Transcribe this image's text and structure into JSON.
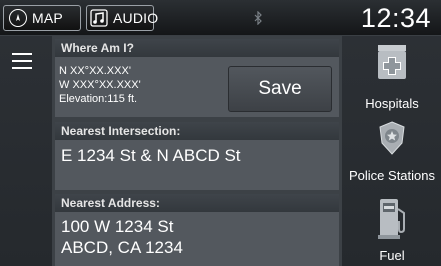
{
  "topbar": {
    "map_label": "MAP",
    "audio_label": "AUDIO",
    "time": "12:34"
  },
  "where_am_i": {
    "header": "Where Am I?",
    "latitude": "N XX°XX.XXX'",
    "longitude": "W XXX°XX.XXX'",
    "elevation": "Elevation:115 ft.",
    "save_label": "Save"
  },
  "nearest_intersection": {
    "header": "Nearest Intersection:",
    "value": "E 1234 St & N ABCD St"
  },
  "nearest_address": {
    "header": "Nearest Address:",
    "line1": "100 W 1234 St",
    "line2": "ABCD, CA 1234"
  },
  "categories": [
    {
      "label": "Hospitals",
      "icon": "hospital-icon"
    },
    {
      "label": "Police Stations",
      "icon": "police-badge-icon"
    },
    {
      "label": "Fuel",
      "icon": "fuel-pump-icon"
    }
  ],
  "colors": {
    "background": "#2c3035",
    "panel": "#53585e",
    "header": "#3f444a"
  }
}
